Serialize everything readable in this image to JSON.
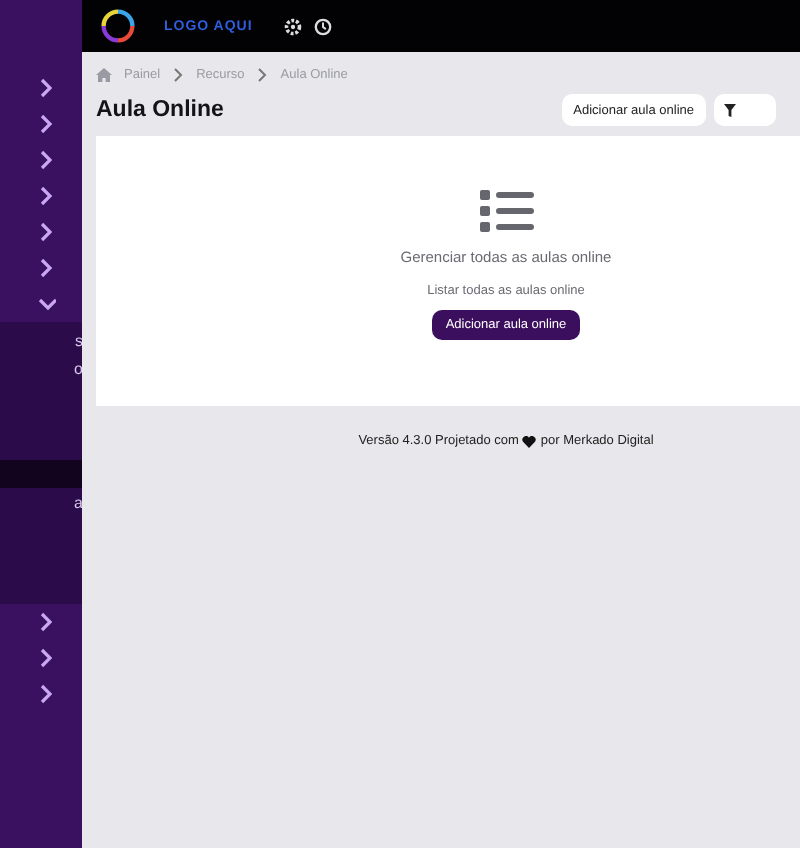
{
  "sidebar": {
    "items": [
      {
        "expanded": false
      },
      {
        "expanded": false
      },
      {
        "expanded": false
      },
      {
        "expanded": false
      },
      {
        "expanded": false
      },
      {
        "expanded": false
      },
      {
        "expanded": true,
        "children": [
          {
            "label": "s",
            "selected": false
          },
          {
            "label": "o",
            "selected": false
          },
          {
            "selected": true
          },
          {
            "label": "a",
            "selected": false
          }
        ]
      },
      {
        "expanded": false
      },
      {
        "expanded": false
      },
      {
        "expanded": false
      }
    ]
  },
  "topbar": {
    "logo_text": "LOGO AQUI"
  },
  "breadcrumb": [
    "Painel",
    "Recurso",
    "Aula Online"
  ],
  "page_title": "Aula Online",
  "header_button": "Adicionar aula online",
  "empty_state": {
    "title": "Gerenciar todas as aulas online",
    "subtitle": "Listar todas as aulas online",
    "button": "Adicionar aula online"
  },
  "footer": {
    "before": "Versão 4.3.0  Projetado com",
    "after": "por Merkado Digital"
  }
}
